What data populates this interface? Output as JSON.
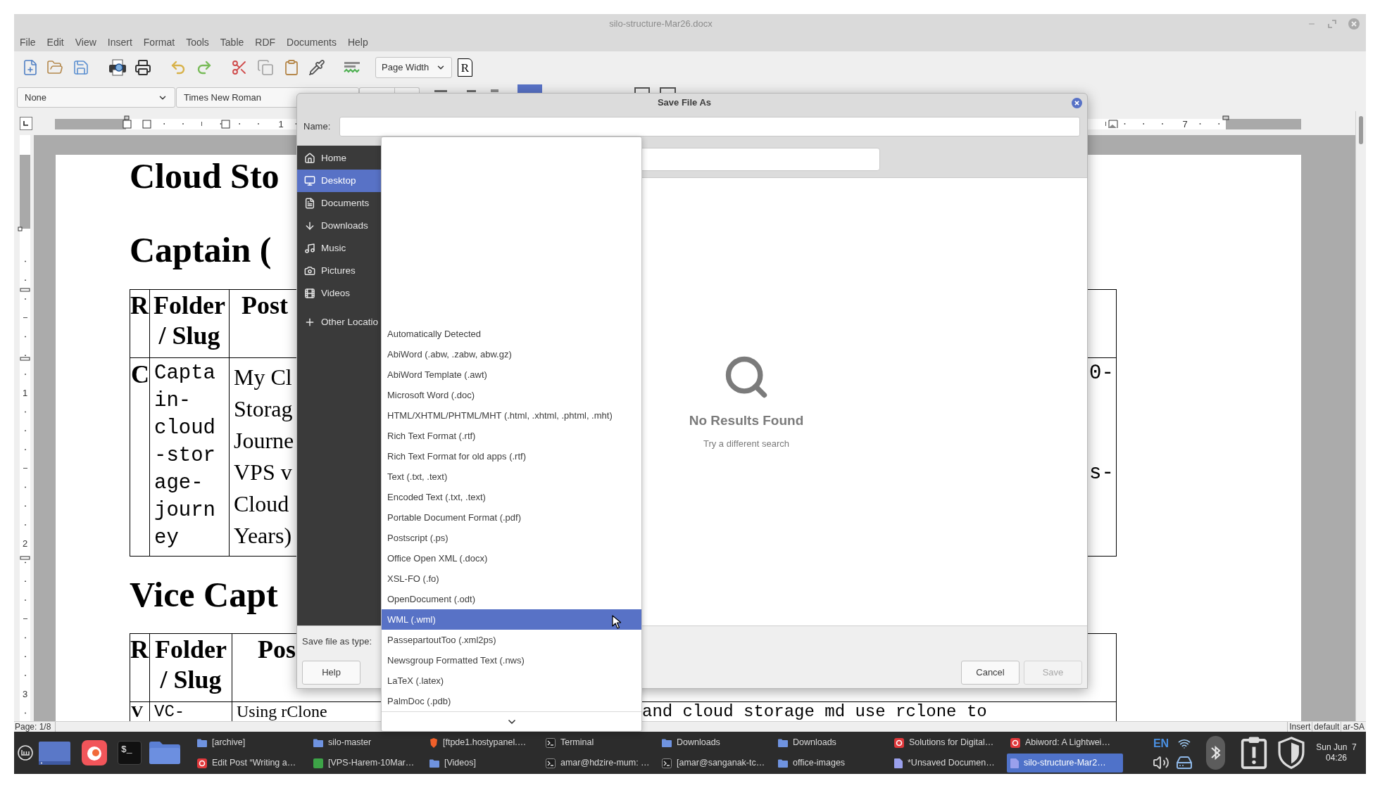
{
  "window": {
    "title": "silo-structure-Mar26.docx"
  },
  "menu_bar": [
    "File",
    "Edit",
    "View",
    "Insert",
    "Format",
    "Tools",
    "Table",
    "RDF",
    "Documents",
    "Help"
  ],
  "toolbar": {
    "zoom_select": "Page Width",
    "glyph_button": "R"
  },
  "format_bar": {
    "style_select": "None",
    "font_select": "Times New Roman"
  },
  "ruler": {
    "labels": [
      "1",
      "7"
    ]
  },
  "vertical_ruler": {
    "labels": [
      "1",
      "2",
      "3"
    ]
  },
  "document": {
    "blocks": [
      {
        "kind": "heading",
        "text": "Cloud Sto"
      },
      {
        "kind": "heading",
        "text": "Captain ("
      },
      {
        "kind": "table",
        "header": {
          "column_1": "R",
          "column_2": "Folder / Slug",
          "column_3": "Post"
        },
        "rows": [
          {
            "column_1": {
              "kind": "bold",
              "text": "C"
            },
            "column_2": {
              "kind": "mono",
              "lines": [
                "Capta",
                "in-",
                "cloud",
                "-stor",
                "age-",
                "journ",
                "ey"
              ]
            },
            "column_3": {
              "kind": "serif",
              "lines": [
                "My Cl",
                "Storag",
                "Journe",
                "VPS v",
                "Cloud",
                "Years)"
              ]
            },
            "column_4": {
              "kind": "mono",
              "fragments": [
                "0-",
                "s-"
              ]
            }
          }
        ]
      },
      {
        "kind": "heading",
        "text": "Vice Capt"
      },
      {
        "kind": "table",
        "header": {
          "column_1": "R",
          "column_2": "Folder / Slug",
          "column_3": "Pos"
        },
        "rows": [
          {
            "column_1": {
              "kind": "bold",
              "text": "V"
            },
            "column_2": {
              "kind": "mono",
              "text": "VC-"
            },
            "column_3": {
              "kind": "serif",
              "text": "Using rClone"
            },
            "column_4": {
              "kind": "mono",
              "text": "and cloud storage md use rclone to"
            }
          }
        ]
      }
    ]
  },
  "status_bar": {
    "page": "Page: 1/8",
    "mode": "Insert",
    "style": "default",
    "language": "ar-SA"
  },
  "dialog": {
    "title": "Save File As",
    "name_label": "Name:",
    "places": [
      {
        "kind": "place",
        "label": "Home",
        "selected": false
      },
      {
        "kind": "place",
        "label": "Desktop",
        "selected": true
      },
      {
        "kind": "place",
        "label": "Documents",
        "selected": false
      },
      {
        "kind": "place",
        "label": "Downloads",
        "selected": false
      },
      {
        "kind": "place",
        "label": "Music",
        "selected": false
      },
      {
        "kind": "place",
        "label": "Pictures",
        "selected": false
      },
      {
        "kind": "place",
        "label": "Videos",
        "selected": false
      },
      {
        "kind": "action",
        "label": "Other Locatio",
        "selected": false
      }
    ],
    "empty_state": {
      "title": "No Results Found",
      "hint": "Try a different search"
    },
    "file_type_label": "Save file as type:",
    "buttons": [
      {
        "label": "Help",
        "disabled": false
      },
      {
        "label": "Cancel",
        "disabled": false
      },
      {
        "label": "Save",
        "disabled": true
      }
    ]
  },
  "file_type_menu": {
    "items": [
      {
        "label": "Automatically Detected",
        "selected": false
      },
      {
        "label": "AbiWord (.abw, .zabw, abw.gz)",
        "selected": false
      },
      {
        "label": "AbiWord Template (.awt)",
        "selected": false
      },
      {
        "label": "Microsoft Word (.doc)",
        "selected": false
      },
      {
        "label": "HTML/XHTML/PHTML/MHT (.html, .xhtml, .phtml, .mht)",
        "selected": false
      },
      {
        "label": "Rich Text Format (.rtf)",
        "selected": false
      },
      {
        "label": "Rich Text Format for old apps (.rtf)",
        "selected": false
      },
      {
        "label": "Text (.txt, .text)",
        "selected": false
      },
      {
        "label": "Encoded Text (.txt, .text)",
        "selected": false
      },
      {
        "label": "Portable Document Format (.pdf)",
        "selected": false
      },
      {
        "label": "Postscript (.ps)",
        "selected": false
      },
      {
        "label": "Office Open XML (.docx)",
        "selected": false
      },
      {
        "label": "XSL-FO (.fo)",
        "selected": false
      },
      {
        "label": "OpenDocument (.odt)",
        "selected": false
      },
      {
        "label": "WML (.wml)",
        "selected": true
      },
      {
        "label": "PassepartoutToo (.xml2ps)",
        "selected": false
      },
      {
        "label": "Newsgroup Formatted Text (.nws)",
        "selected": false
      },
      {
        "label": "LaTeX (.latex)",
        "selected": false
      },
      {
        "label": "PalmDoc (.pdb)",
        "selected": false
      }
    ]
  },
  "taskbar": {
    "launchers": [
      {
        "kind": "menu"
      },
      {
        "kind": "desktop"
      },
      {
        "kind": "browser"
      },
      {
        "kind": "terminal",
        "glyph": "$_"
      },
      {
        "kind": "files"
      }
    ],
    "windows": [
      {
        "title": "[archive]",
        "kind": "folder",
        "selected": false
      },
      {
        "title": "silo-master",
        "kind": "folder",
        "selected": false
      },
      {
        "title": "[ftpde1.hostypanel.…",
        "kind": "shield",
        "selected": false
      },
      {
        "title": "Terminal",
        "kind": "terminal",
        "selected": false
      },
      {
        "title": "Downloads",
        "kind": "folder",
        "selected": false
      },
      {
        "title": "Downloads",
        "kind": "folder",
        "selected": false
      },
      {
        "title": "Solutions for Digital…",
        "kind": "app",
        "selected": false
      },
      {
        "title": "Abiword: A Lightwei…",
        "kind": "app",
        "selected": false
      },
      {
        "title": "Edit Post “Writing a…",
        "kind": "app",
        "selected": false
      },
      {
        "title": "[VPS-Harem-10Mar…",
        "kind": "green_app",
        "selected": false
      },
      {
        "title": "[Videos]",
        "kind": "folder",
        "selected": false
      },
      {
        "title": "amar@hdzire-mum: …",
        "kind": "terminal",
        "selected": false
      },
      {
        "title": "[amar@sanganak-tc…",
        "kind": "terminal",
        "selected": false
      },
      {
        "title": "office-images",
        "kind": "folder",
        "selected": false
      },
      {
        "title": "*Unsaved Documen…",
        "kind": "document",
        "selected": false
      },
      {
        "title": "silo-structure-Mar2…",
        "kind": "document",
        "selected": true
      }
    ],
    "tray": {
      "language": "EN",
      "date": "Sun Jun  7",
      "time": "04:26"
    }
  }
}
